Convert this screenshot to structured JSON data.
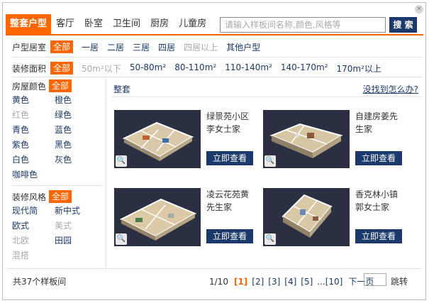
{
  "tabs": [
    "整套户型",
    "客厅",
    "卧室",
    "卫生间",
    "厨房",
    "儿童房"
  ],
  "search": {
    "placeholder": "请输入样板间名称,颜色,风格等",
    "button": "搜 索"
  },
  "layout_filter": {
    "label": "户型居室",
    "all": "全部",
    "options": [
      {
        "t": "一居",
        "d": false
      },
      {
        "t": "二居",
        "d": false
      },
      {
        "t": "三居",
        "d": false
      },
      {
        "t": "四居",
        "d": false
      },
      {
        "t": "四居以上",
        "d": true
      },
      {
        "t": "其他户型",
        "d": false
      }
    ]
  },
  "area_filter": {
    "label": "装修面积",
    "all": "全部",
    "options": [
      {
        "t": "50m²以下",
        "d": true
      },
      {
        "t": "50-80m²",
        "d": false
      },
      {
        "t": "80-110m²",
        "d": false
      },
      {
        "t": "110-140m²",
        "d": false
      },
      {
        "t": "140-170m²",
        "d": false
      },
      {
        "t": "170m²以上",
        "d": false
      }
    ]
  },
  "colors": {
    "label": "房屋颜色",
    "all": "全部",
    "options": [
      {
        "t": "黄色",
        "d": false
      },
      {
        "t": "橙色",
        "d": false
      },
      {
        "t": "红色",
        "d": true
      },
      {
        "t": "绿色",
        "d": false
      },
      {
        "t": "青色",
        "d": false
      },
      {
        "t": "蓝色",
        "d": false
      },
      {
        "t": "紫色",
        "d": false
      },
      {
        "t": "黑色",
        "d": false
      },
      {
        "t": "白色",
        "d": false
      },
      {
        "t": "灰色",
        "d": false
      },
      {
        "t": "咖啡色",
        "d": false
      }
    ]
  },
  "styles": {
    "label": "装修风格",
    "all": "全部",
    "options": [
      {
        "t": "现代简",
        "d": false
      },
      {
        "t": "新中式",
        "d": false
      },
      {
        "t": "欧式",
        "d": false
      },
      {
        "t": "美式",
        "d": true
      },
      {
        "t": "北欧",
        "d": true
      },
      {
        "t": "田园",
        "d": false
      },
      {
        "t": "混搭",
        "d": true
      }
    ]
  },
  "main": {
    "title": "整套",
    "link": "没找到怎么办?"
  },
  "cards": [
    {
      "name": "绿景苑小区李女士家",
      "button": "立即查看"
    },
    {
      "name": "自建房姜先生家",
      "button": "立即查看"
    },
    {
      "name": "凌云花苑黄先生家",
      "button": "立即查看"
    },
    {
      "name": "香克林小镇郭女士家",
      "button": "立即查看"
    }
  ],
  "footer": {
    "total": "共37个样板间",
    "page_info": "1/10",
    "pages": [
      "[1]",
      "[2]",
      "[3]",
      "[4]",
      "[5]",
      "...",
      "[10]"
    ],
    "next": "下一页",
    "jump": "跳转"
  }
}
